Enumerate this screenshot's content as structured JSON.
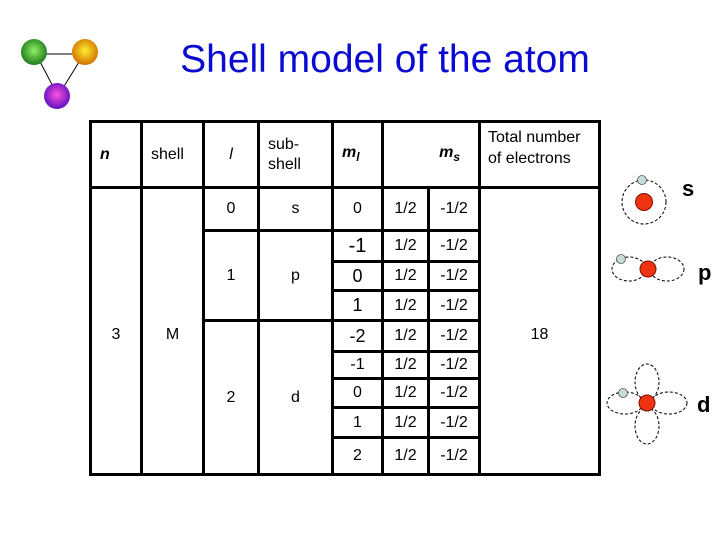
{
  "title": "Shell model of the atom",
  "logo": {
    "colors": {
      "green": "#2ca02c",
      "orange": "#f0a000",
      "purple": "#b020e0"
    }
  },
  "table": {
    "headers": {
      "n": "n",
      "shell": "shell",
      "l": "l",
      "subshell_line1": "sub-",
      "subshell_line2": "shell",
      "ml": "m",
      "ml_sub": "l",
      "ms": "m",
      "ms_sub": "s",
      "total_line1": "Total number",
      "total_line2": "of electrons"
    },
    "n_value": "3",
    "shell_value": "M",
    "total_value": "18",
    "subshells": [
      {
        "l": "0",
        "name": "s",
        "rows": [
          {
            "ml": "0",
            "ms_up": "1/2",
            "ms_down": "-1/2"
          }
        ]
      },
      {
        "l": "1",
        "name": "p",
        "rows": [
          {
            "ml": "-1",
            "ms_up": "1/2",
            "ms_down": "-1/2"
          },
          {
            "ml": "0",
            "ms_up": "1/2",
            "ms_down": "-1/2"
          },
          {
            "ml": "1",
            "ms_up": "1/2",
            "ms_down": "-1/2"
          }
        ]
      },
      {
        "l": "2",
        "name": "d",
        "rows": [
          {
            "ml": "-2",
            "ms_up": "1/2",
            "ms_down": "-1/2"
          },
          {
            "ml": "-1",
            "ms_up": "1/2",
            "ms_down": "-1/2"
          },
          {
            "ml": "0",
            "ms_up": "1/2",
            "ms_down": "-1/2"
          },
          {
            "ml": "1",
            "ms_up": "1/2",
            "ms_down": "-1/2"
          },
          {
            "ml": "2",
            "ms_up": "1/2",
            "ms_down": "-1/2"
          }
        ]
      }
    ]
  },
  "orbitals": [
    {
      "label": "s",
      "type": "s-orbital"
    },
    {
      "label": "p",
      "type": "p-orbital"
    },
    {
      "label": "d",
      "type": "d-orbital"
    }
  ],
  "colors": {
    "title": "#0a0ad2",
    "nucleus": "#ee3311",
    "electron": "#c8dcdc"
  }
}
